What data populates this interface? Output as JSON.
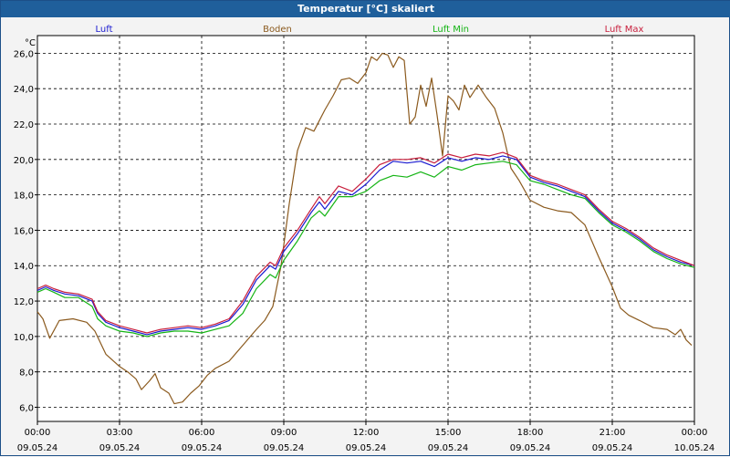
{
  "window": {
    "title": "Temperatur [°C] skaliert"
  },
  "colors": {
    "titlebar": "#1f5f9b",
    "plot_bg": "#ffffff",
    "grid": "#000000"
  },
  "chart_data": {
    "type": "line",
    "ylabel": "°C",
    "ylim": [
      5.2,
      27.0
    ],
    "yticks": [
      6.0,
      8.0,
      10.0,
      12.0,
      14.0,
      16.0,
      18.0,
      20.0,
      22.0,
      24.0,
      26.0
    ],
    "ytick_labels": [
      "6,0",
      "8,0",
      "10,0",
      "12,0",
      "14,0",
      "16,0",
      "18,0",
      "20,0",
      "22,0",
      "24,0",
      "26,0"
    ],
    "xlim_hours": [
      0,
      24
    ],
    "xticks": [
      {
        "h": 0,
        "time": "00:00",
        "date": "09.05.24"
      },
      {
        "h": 3,
        "time": "03:00",
        "date": "09.05.24"
      },
      {
        "h": 6,
        "time": "06:00",
        "date": "09.05.24"
      },
      {
        "h": 9,
        "time": "09:00",
        "date": "09.05.24"
      },
      {
        "h": 12,
        "time": "12:00",
        "date": "09.05.24"
      },
      {
        "h": 15,
        "time": "15:00",
        "date": "09.05.24"
      },
      {
        "h": 18,
        "time": "18:00",
        "date": "09.05.24"
      },
      {
        "h": 21,
        "time": "21:00",
        "date": "09.05.24"
      },
      {
        "h": 24,
        "time": "00:00",
        "date": "10.05.24"
      }
    ],
    "legend_position": "top",
    "series": [
      {
        "name": "Luft",
        "color": "#1a1ad0",
        "points": [
          [
            0,
            12.6
          ],
          [
            0.3,
            12.8
          ],
          [
            0.6,
            12.6
          ],
          [
            1.0,
            12.4
          ],
          [
            1.5,
            12.3
          ],
          [
            2.0,
            12.0
          ],
          [
            2.2,
            11.3
          ],
          [
            2.5,
            10.8
          ],
          [
            3.0,
            10.5
          ],
          [
            3.5,
            10.3
          ],
          [
            4.0,
            10.1
          ],
          [
            4.5,
            10.3
          ],
          [
            5.0,
            10.4
          ],
          [
            5.5,
            10.5
          ],
          [
            6.0,
            10.4
          ],
          [
            6.5,
            10.6
          ],
          [
            7.0,
            10.9
          ],
          [
            7.5,
            11.8
          ],
          [
            8.0,
            13.2
          ],
          [
            8.5,
            14.0
          ],
          [
            8.7,
            13.8
          ],
          [
            9.0,
            14.8
          ],
          [
            9.5,
            15.8
          ],
          [
            10.0,
            17.0
          ],
          [
            10.3,
            17.6
          ],
          [
            10.5,
            17.2
          ],
          [
            11.0,
            18.2
          ],
          [
            11.5,
            18.0
          ],
          [
            12.0,
            18.6
          ],
          [
            12.5,
            19.4
          ],
          [
            13.0,
            19.9
          ],
          [
            13.5,
            19.8
          ],
          [
            14.0,
            19.9
          ],
          [
            14.5,
            19.6
          ],
          [
            15.0,
            20.1
          ],
          [
            15.5,
            19.9
          ],
          [
            16.0,
            20.1
          ],
          [
            16.5,
            20.0
          ],
          [
            17.0,
            20.2
          ],
          [
            17.5,
            20.0
          ],
          [
            18.0,
            19.0
          ],
          [
            18.5,
            18.7
          ],
          [
            19.0,
            18.5
          ],
          [
            19.5,
            18.2
          ],
          [
            20.0,
            17.9
          ],
          [
            20.5,
            17.1
          ],
          [
            21.0,
            16.4
          ],
          [
            21.5,
            16.0
          ],
          [
            22.0,
            15.5
          ],
          [
            22.5,
            14.9
          ],
          [
            23.0,
            14.5
          ],
          [
            23.5,
            14.2
          ],
          [
            24.0,
            14.0
          ]
        ]
      },
      {
        "name": "Boden",
        "color": "#8b5a1e",
        "points": [
          [
            0,
            11.4
          ],
          [
            0.2,
            11.0
          ],
          [
            0.45,
            9.9
          ],
          [
            0.8,
            10.9
          ],
          [
            1.3,
            11.0
          ],
          [
            1.8,
            10.8
          ],
          [
            2.1,
            10.3
          ],
          [
            2.5,
            9.0
          ],
          [
            3.0,
            8.3
          ],
          [
            3.3,
            8.0
          ],
          [
            3.6,
            7.6
          ],
          [
            3.8,
            7.0
          ],
          [
            4.1,
            7.5
          ],
          [
            4.3,
            7.9
          ],
          [
            4.5,
            7.1
          ],
          [
            4.8,
            6.8
          ],
          [
            5.0,
            6.2
          ],
          [
            5.3,
            6.3
          ],
          [
            5.6,
            6.8
          ],
          [
            5.9,
            7.2
          ],
          [
            6.2,
            7.8
          ],
          [
            6.5,
            8.2
          ],
          [
            7.0,
            8.6
          ],
          [
            7.5,
            9.5
          ],
          [
            8.0,
            10.4
          ],
          [
            8.3,
            10.9
          ],
          [
            8.6,
            11.7
          ],
          [
            8.9,
            14.0
          ],
          [
            9.2,
            17.5
          ],
          [
            9.5,
            20.5
          ],
          [
            9.8,
            21.8
          ],
          [
            10.1,
            21.6
          ],
          [
            10.5,
            22.8
          ],
          [
            10.8,
            23.6
          ],
          [
            11.1,
            24.5
          ],
          [
            11.4,
            24.6
          ],
          [
            11.7,
            24.3
          ],
          [
            12.0,
            24.9
          ],
          [
            12.2,
            25.8
          ],
          [
            12.4,
            25.6
          ],
          [
            12.6,
            26.0
          ],
          [
            12.8,
            25.9
          ],
          [
            13.0,
            25.2
          ],
          [
            13.2,
            25.8
          ],
          [
            13.4,
            25.6
          ],
          [
            13.6,
            22.0
          ],
          [
            13.8,
            22.4
          ],
          [
            14.0,
            24.2
          ],
          [
            14.2,
            23.0
          ],
          [
            14.4,
            24.6
          ],
          [
            14.6,
            22.5
          ],
          [
            14.8,
            20.2
          ],
          [
            15.0,
            23.6
          ],
          [
            15.2,
            23.3
          ],
          [
            15.4,
            22.8
          ],
          [
            15.6,
            24.2
          ],
          [
            15.8,
            23.5
          ],
          [
            16.1,
            24.2
          ],
          [
            16.4,
            23.5
          ],
          [
            16.7,
            22.9
          ],
          [
            17.0,
            21.5
          ],
          [
            17.3,
            19.5
          ],
          [
            17.6,
            18.8
          ],
          [
            18.0,
            17.7
          ],
          [
            18.5,
            17.3
          ],
          [
            19.0,
            17.1
          ],
          [
            19.5,
            17.0
          ],
          [
            20.0,
            16.3
          ],
          [
            20.5,
            14.5
          ],
          [
            21.0,
            12.8
          ],
          [
            21.3,
            11.6
          ],
          [
            21.6,
            11.2
          ],
          [
            22.0,
            10.9
          ],
          [
            22.5,
            10.5
          ],
          [
            23.0,
            10.4
          ],
          [
            23.3,
            10.1
          ],
          [
            23.5,
            10.4
          ],
          [
            23.7,
            9.8
          ],
          [
            23.9,
            9.5
          ]
        ]
      },
      {
        "name": "Luft Min",
        "color": "#14b414",
        "points": [
          [
            0,
            12.5
          ],
          [
            0.3,
            12.7
          ],
          [
            0.6,
            12.5
          ],
          [
            1.0,
            12.2
          ],
          [
            1.5,
            12.2
          ],
          [
            2.0,
            11.7
          ],
          [
            2.2,
            11.0
          ],
          [
            2.5,
            10.6
          ],
          [
            3.0,
            10.3
          ],
          [
            3.5,
            10.2
          ],
          [
            4.0,
            10.0
          ],
          [
            4.5,
            10.2
          ],
          [
            5.0,
            10.3
          ],
          [
            5.5,
            10.3
          ],
          [
            6.0,
            10.2
          ],
          [
            6.5,
            10.4
          ],
          [
            7.0,
            10.6
          ],
          [
            7.5,
            11.3
          ],
          [
            8.0,
            12.7
          ],
          [
            8.5,
            13.5
          ],
          [
            8.7,
            13.3
          ],
          [
            9.0,
            14.3
          ],
          [
            9.5,
            15.4
          ],
          [
            10.0,
            16.7
          ],
          [
            10.3,
            17.1
          ],
          [
            10.5,
            16.8
          ],
          [
            11.0,
            17.9
          ],
          [
            11.5,
            17.9
          ],
          [
            12.0,
            18.2
          ],
          [
            12.5,
            18.8
          ],
          [
            13.0,
            19.1
          ],
          [
            13.5,
            19.0
          ],
          [
            14.0,
            19.3
          ],
          [
            14.5,
            19.0
          ],
          [
            15.0,
            19.6
          ],
          [
            15.5,
            19.4
          ],
          [
            16.0,
            19.7
          ],
          [
            16.5,
            19.8
          ],
          [
            17.0,
            19.9
          ],
          [
            17.5,
            19.7
          ],
          [
            18.0,
            18.8
          ],
          [
            18.5,
            18.6
          ],
          [
            19.0,
            18.3
          ],
          [
            19.5,
            18.0
          ],
          [
            20.0,
            17.8
          ],
          [
            20.5,
            17.0
          ],
          [
            21.0,
            16.3
          ],
          [
            21.5,
            15.9
          ],
          [
            22.0,
            15.4
          ],
          [
            22.5,
            14.8
          ],
          [
            23.0,
            14.4
          ],
          [
            23.5,
            14.1
          ],
          [
            24.0,
            13.9
          ]
        ]
      },
      {
        "name": "Luft Max",
        "color": "#c81e3c",
        "points": [
          [
            0,
            12.7
          ],
          [
            0.3,
            12.9
          ],
          [
            0.6,
            12.7
          ],
          [
            1.0,
            12.5
          ],
          [
            1.5,
            12.4
          ],
          [
            2.0,
            12.1
          ],
          [
            2.2,
            11.4
          ],
          [
            2.5,
            10.9
          ],
          [
            3.0,
            10.6
          ],
          [
            3.5,
            10.4
          ],
          [
            4.0,
            10.2
          ],
          [
            4.5,
            10.4
          ],
          [
            5.0,
            10.5
          ],
          [
            5.5,
            10.6
          ],
          [
            6.0,
            10.5
          ],
          [
            6.5,
            10.7
          ],
          [
            7.0,
            11.0
          ],
          [
            7.5,
            12.0
          ],
          [
            8.0,
            13.4
          ],
          [
            8.5,
            14.2
          ],
          [
            8.7,
            14.0
          ],
          [
            9.0,
            15.0
          ],
          [
            9.5,
            16.0
          ],
          [
            10.0,
            17.2
          ],
          [
            10.3,
            17.9
          ],
          [
            10.5,
            17.5
          ],
          [
            11.0,
            18.5
          ],
          [
            11.5,
            18.2
          ],
          [
            12.0,
            18.9
          ],
          [
            12.5,
            19.7
          ],
          [
            13.0,
            20.0
          ],
          [
            13.5,
            20.0
          ],
          [
            14.0,
            20.1
          ],
          [
            14.5,
            19.8
          ],
          [
            15.0,
            20.3
          ],
          [
            15.5,
            20.1
          ],
          [
            16.0,
            20.3
          ],
          [
            16.5,
            20.2
          ],
          [
            17.0,
            20.4
          ],
          [
            17.5,
            20.1
          ],
          [
            18.0,
            19.1
          ],
          [
            18.5,
            18.8
          ],
          [
            19.0,
            18.6
          ],
          [
            19.5,
            18.3
          ],
          [
            20.0,
            18.0
          ],
          [
            20.5,
            17.2
          ],
          [
            21.0,
            16.5
          ],
          [
            21.5,
            16.1
          ],
          [
            22.0,
            15.6
          ],
          [
            22.5,
            15.0
          ],
          [
            23.0,
            14.6
          ],
          [
            23.5,
            14.3
          ],
          [
            24.0,
            14.0
          ]
        ]
      }
    ]
  }
}
